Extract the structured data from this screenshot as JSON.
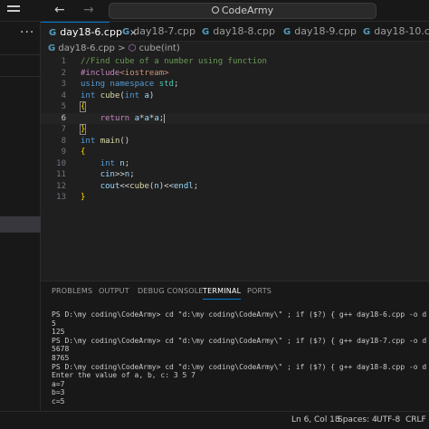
{
  "titlebar": {
    "search_text": "CodeArmy",
    "back_arrow": "←",
    "forward_arrow": "→"
  },
  "sidebar": {
    "more_glyph": "···"
  },
  "tabs": [
    {
      "label": "day18-6.cpp",
      "active": true,
      "close": "×"
    },
    {
      "label": "day18-7.cpp",
      "active": false
    },
    {
      "label": "day18-8.cpp",
      "active": false
    },
    {
      "label": "day18-9.cpp",
      "active": false
    },
    {
      "label": "day18-10.cpp",
      "active": false
    }
  ],
  "tab_icon": "G",
  "breadcrumb": {
    "file": "day18-6.cpp",
    "separator": ">",
    "symbol": "cube(int)",
    "file_icon": "G",
    "symbol_icon": "⬡"
  },
  "editor": {
    "line_numbers": [
      "1",
      "2",
      "3",
      "4",
      "5",
      "6",
      "7",
      "8",
      "9",
      "10",
      "11",
      "12",
      "13"
    ],
    "current_line": 6
  },
  "panel": {
    "tabs": [
      "PROBLEMS",
      "OUTPUT",
      "DEBUG CONSOLE",
      "TERMINAL",
      "PORTS"
    ],
    "active_tab": "TERMINAL",
    "terminal_lines": [
      "PS D:\\my coding\\CodeArmy> cd \"d:\\my coding\\CodeArmy\\\" ; if ($?) { g++ day18-6.cpp -o d",
      "5",
      "125",
      "PS D:\\my coding\\CodeArmy> cd \"d:\\my coding\\CodeArmy\\\" ; if ($?) { g++ day18-7.cpp -o d",
      "5678",
      "8765",
      "PS D:\\my coding\\CodeArmy> cd \"d:\\my coding\\CodeArmy\\\" ; if ($?) { g++ day18-8.cpp -o d",
      "Enter the value of a, b, c: 3 5 7",
      "a=7",
      "b=3",
      "c=5"
    ]
  },
  "statusbar": {
    "position": "Ln 6, Col 18",
    "spaces": "Spaces: 4",
    "encoding": "UTF-8",
    "eol": "CRLF"
  },
  "colors": {
    "accent": "#0078d4",
    "background": "#1f1f1f",
    "comment": "#6a9955",
    "keyword": "#569cd6",
    "string": "#ce9178",
    "function": "#dcdcaa"
  }
}
